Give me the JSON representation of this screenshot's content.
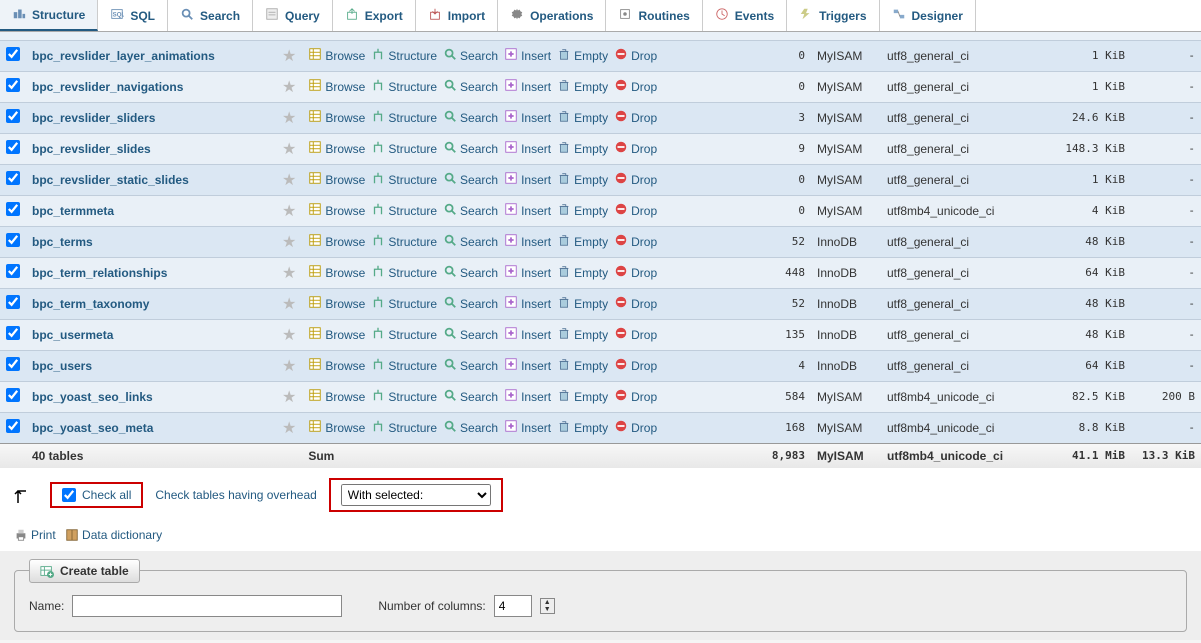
{
  "tabs": [
    {
      "label": "Structure",
      "icon": "structure"
    },
    {
      "label": "SQL",
      "icon": "sql"
    },
    {
      "label": "Search",
      "icon": "search"
    },
    {
      "label": "Query",
      "icon": "query"
    },
    {
      "label": "Export",
      "icon": "export"
    },
    {
      "label": "Import",
      "icon": "import"
    },
    {
      "label": "Operations",
      "icon": "operations"
    },
    {
      "label": "Routines",
      "icon": "routines"
    },
    {
      "label": "Events",
      "icon": "events"
    },
    {
      "label": "Triggers",
      "icon": "triggers"
    },
    {
      "label": "Designer",
      "icon": "designer"
    }
  ],
  "active_tab": 0,
  "actions": {
    "browse": "Browse",
    "structure": "Structure",
    "search": "Search",
    "insert": "Insert",
    "empty": "Empty",
    "drop": "Drop"
  },
  "tables": [
    {
      "name": "bpc_revslider_layer_animations",
      "rows": "0",
      "engine": "MyISAM",
      "collation": "utf8_general_ci",
      "size": "1 KiB",
      "overhead": "-"
    },
    {
      "name": "bpc_revslider_navigations",
      "rows": "0",
      "engine": "MyISAM",
      "collation": "utf8_general_ci",
      "size": "1 KiB",
      "overhead": "-"
    },
    {
      "name": "bpc_revslider_sliders",
      "rows": "3",
      "engine": "MyISAM",
      "collation": "utf8_general_ci",
      "size": "24.6 KiB",
      "overhead": "-"
    },
    {
      "name": "bpc_revslider_slides",
      "rows": "9",
      "engine": "MyISAM",
      "collation": "utf8_general_ci",
      "size": "148.3 KiB",
      "overhead": "-"
    },
    {
      "name": "bpc_revslider_static_slides",
      "rows": "0",
      "engine": "MyISAM",
      "collation": "utf8_general_ci",
      "size": "1 KiB",
      "overhead": "-"
    },
    {
      "name": "bpc_termmeta",
      "rows": "0",
      "engine": "MyISAM",
      "collation": "utf8mb4_unicode_ci",
      "size": "4 KiB",
      "overhead": "-"
    },
    {
      "name": "bpc_terms",
      "rows": "52",
      "engine": "InnoDB",
      "collation": "utf8_general_ci",
      "size": "48 KiB",
      "overhead": "-"
    },
    {
      "name": "bpc_term_relationships",
      "rows": "448",
      "engine": "InnoDB",
      "collation": "utf8_general_ci",
      "size": "64 KiB",
      "overhead": "-"
    },
    {
      "name": "bpc_term_taxonomy",
      "rows": "52",
      "engine": "InnoDB",
      "collation": "utf8_general_ci",
      "size": "48 KiB",
      "overhead": "-"
    },
    {
      "name": "bpc_usermeta",
      "rows": "135",
      "engine": "InnoDB",
      "collation": "utf8_general_ci",
      "size": "48 KiB",
      "overhead": "-"
    },
    {
      "name": "bpc_users",
      "rows": "4",
      "engine": "InnoDB",
      "collation": "utf8_general_ci",
      "size": "64 KiB",
      "overhead": "-"
    },
    {
      "name": "bpc_yoast_seo_links",
      "rows": "584",
      "engine": "MyISAM",
      "collation": "utf8mb4_unicode_ci",
      "size": "82.5 KiB",
      "overhead": "200 B"
    },
    {
      "name": "bpc_yoast_seo_meta",
      "rows": "168",
      "engine": "MyISAM",
      "collation": "utf8mb4_unicode_ci",
      "size": "8.8 KiB",
      "overhead": "-"
    }
  ],
  "summary": {
    "count_label": "40 tables",
    "sum_label": "Sum",
    "rows": "8,983",
    "engine": "MyISAM",
    "collation": "utf8mb4_unicode_ci",
    "size": "41.1 MiB",
    "overhead": "13.3 KiB"
  },
  "footer": {
    "check_all": "Check all",
    "overhead_link": "Check tables having overhead",
    "with_selected": "With selected:",
    "print": "Print",
    "data_dict": "Data dictionary"
  },
  "create": {
    "legend": "Create table",
    "name_label": "Name:",
    "name_value": "",
    "cols_label": "Number of columns:",
    "cols_value": "4"
  }
}
